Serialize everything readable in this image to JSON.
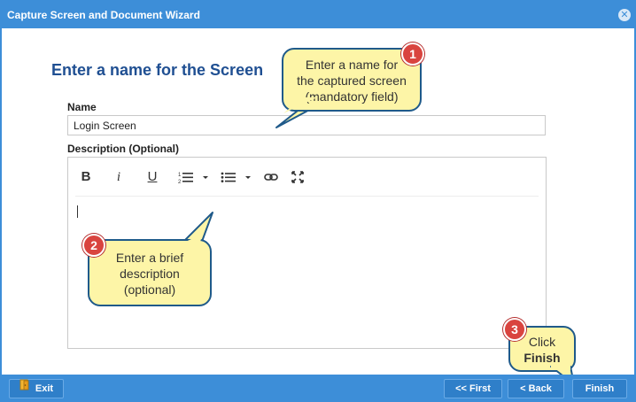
{
  "window": {
    "title": "Capture Screen and Document Wizard",
    "close_icon": "close-icon"
  },
  "main": {
    "heading": "Enter a name for the Screen",
    "name_label": "Name",
    "name_value": "Login Screen",
    "description_label": "Description (Optional)",
    "description_value": ""
  },
  "editor_toolbar": {
    "bold": "B",
    "italic": "i",
    "underline": "U",
    "icons": [
      "ordered-list-icon",
      "unordered-list-icon",
      "link-icon",
      "fullscreen-icon"
    ]
  },
  "footer": {
    "exit_label": "Exit",
    "first_label": "<< First",
    "back_label": "< Back",
    "finish_label": "Finish"
  },
  "callouts": [
    {
      "number": "1",
      "lines": [
        "Enter a name for",
        "the captured screen",
        "(mandatory field)"
      ]
    },
    {
      "number": "2",
      "lines": [
        "Enter a brief",
        "description",
        "(optional)"
      ]
    },
    {
      "number": "3",
      "line1": "Click",
      "line2": "Finish"
    }
  ],
  "colors": {
    "accent": "#3d8ed8",
    "heading": "#1f4f92",
    "callout_fill": "#fdf5a7",
    "callout_border": "#1f5a8a",
    "badge": "#d9443f"
  }
}
